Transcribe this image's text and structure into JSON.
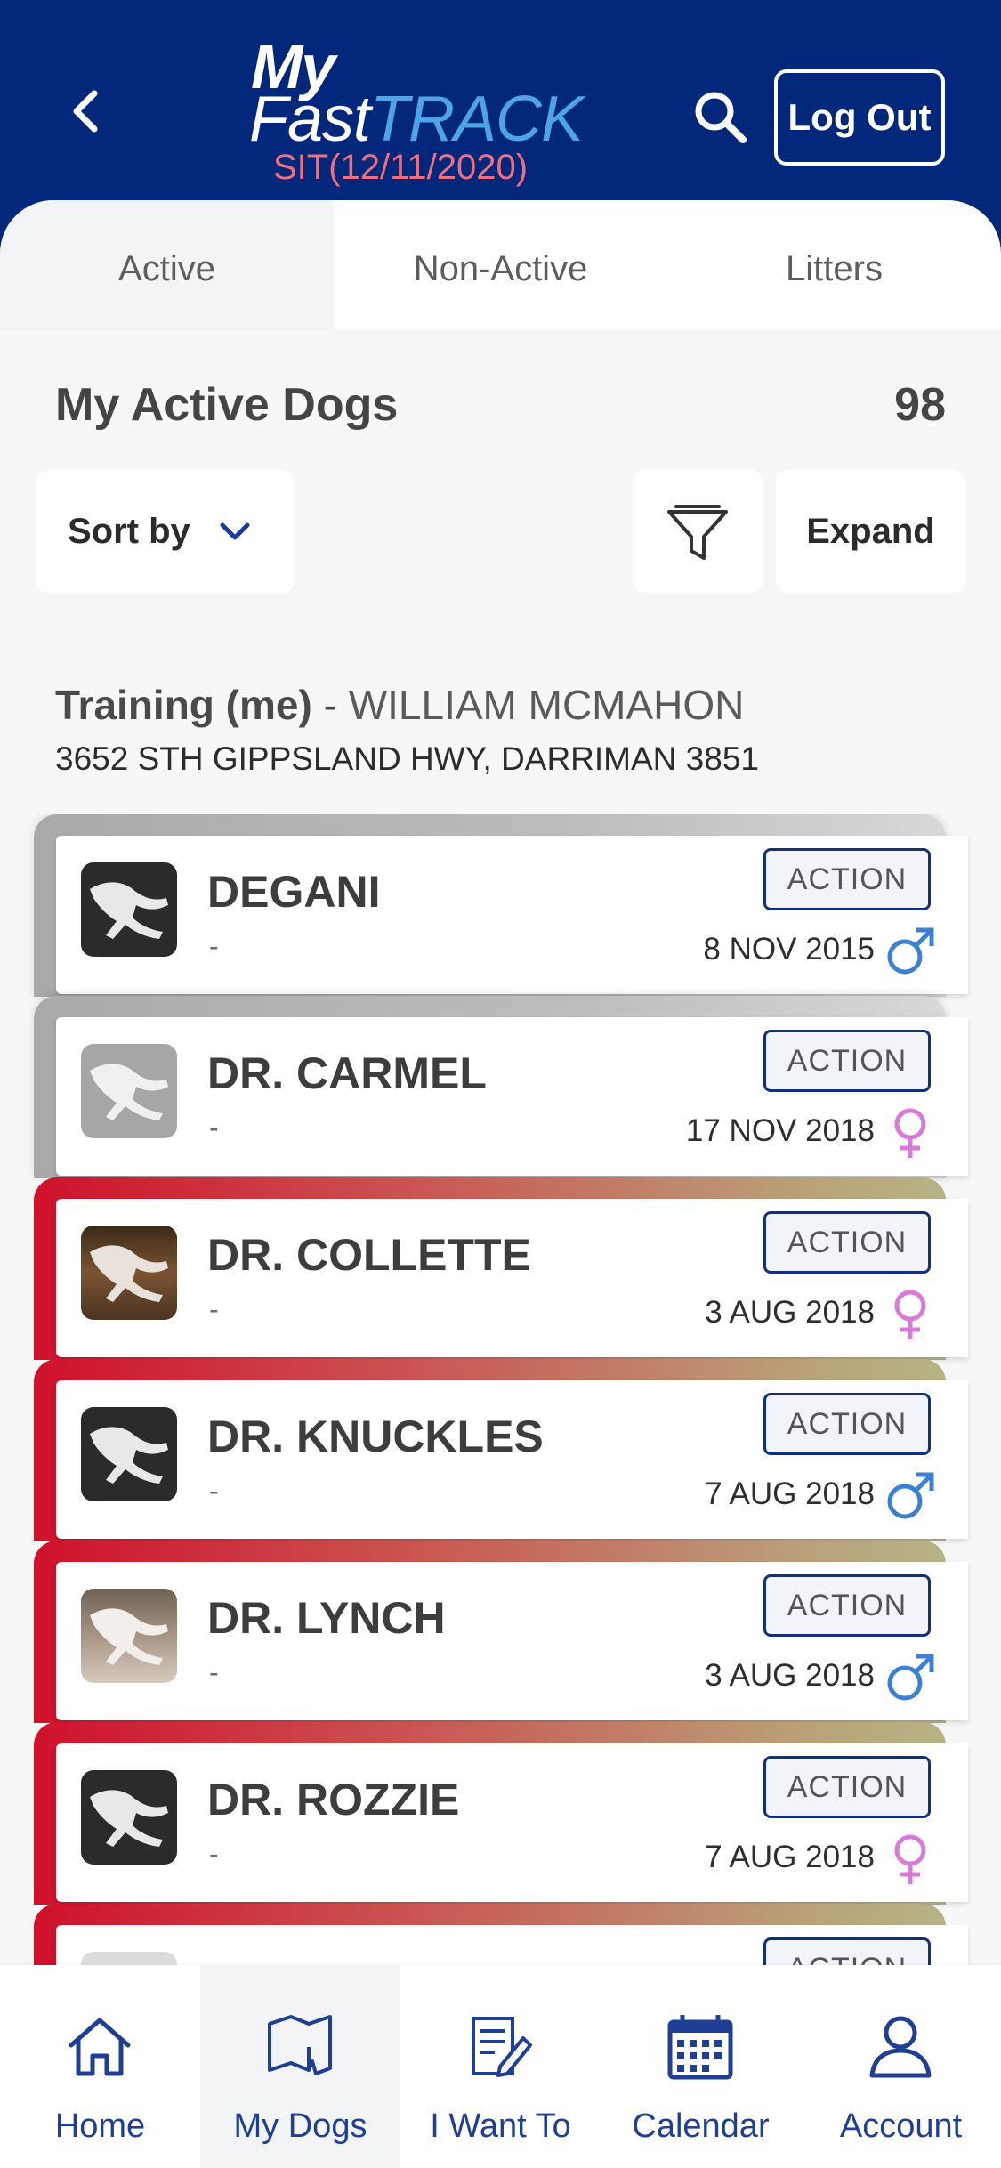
{
  "header": {
    "logo_my": "My",
    "logo_fast": "Fast",
    "logo_track": "TRACK",
    "environment": "SIT(12/11/2020)",
    "logout_label": "Log Out"
  },
  "tabs": [
    {
      "label": "Active",
      "selected": true
    },
    {
      "label": "Non-Active",
      "selected": false
    },
    {
      "label": "Litters",
      "selected": false
    }
  ],
  "section": {
    "title": "My Active Dogs",
    "count": "98"
  },
  "controls": {
    "sort_label": "Sort by",
    "expand_label": "Expand"
  },
  "trainer": {
    "role": "Training (me)",
    "separator": " - ",
    "name": "WILLIAM MCMAHON",
    "address": "3652 STH GIPPSLAND HWY, DARRIMAN 3851"
  },
  "dogs": [
    {
      "name": "DEGANI",
      "sub": "-",
      "action": "ACTION",
      "date": "8 NOV 2015",
      "sex": "male",
      "status_color": "grey",
      "avatar": "dark"
    },
    {
      "name": "DR. CARMEL",
      "sub": "-",
      "action": "ACTION",
      "date": "17 NOV 2018",
      "sex": "female",
      "status_color": "grey",
      "avatar": "grey"
    },
    {
      "name": "DR. COLLETTE",
      "sub": "-",
      "action": "ACTION",
      "date": "3 AUG 2018",
      "sex": "female",
      "status_color": "red",
      "avatar": "brown"
    },
    {
      "name": "DR. KNUCKLES",
      "sub": "-",
      "action": "ACTION",
      "date": "7 AUG 2018",
      "sex": "male",
      "status_color": "red",
      "avatar": "dark"
    },
    {
      "name": "DR. LYNCH",
      "sub": "-",
      "action": "ACTION",
      "date": "3 AUG 2018",
      "sex": "male",
      "status_color": "red",
      "avatar": "fawn"
    },
    {
      "name": "DR. ROZZIE",
      "sub": "-",
      "action": "ACTION",
      "date": "7 AUG 2018",
      "sex": "female",
      "status_color": "red",
      "avatar": "dark"
    }
  ],
  "partial_row": {
    "action": "ACTION"
  },
  "colors": {
    "header_bg": "#03277a",
    "male": "#3d7fd0",
    "female": "#d77bd6",
    "accent": "#13307f"
  },
  "nav": [
    {
      "label": "Home",
      "icon": "home-icon",
      "active": false
    },
    {
      "label": "My Dogs",
      "icon": "map-icon",
      "active": true
    },
    {
      "label": "I Want To",
      "icon": "edit-document-icon",
      "active": false
    },
    {
      "label": "Calendar",
      "icon": "calendar-icon",
      "active": false
    },
    {
      "label": "Account",
      "icon": "user-icon",
      "active": false
    }
  ]
}
